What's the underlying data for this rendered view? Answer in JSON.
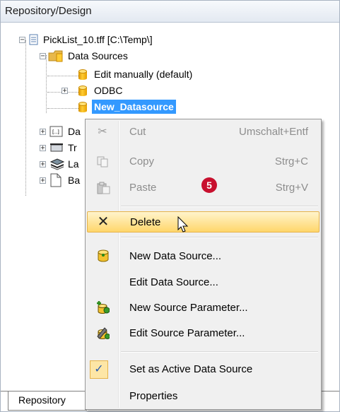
{
  "window": {
    "title": "Repository/Design"
  },
  "tree": {
    "root": "PickList_10.tff [C:\\Temp\\]",
    "data_sources": "Data Sources",
    "items": [
      "Edit manually (default)",
      "ODBC",
      "New_Datasource"
    ],
    "partial": [
      "Da",
      "Tr",
      "La",
      "Ba"
    ]
  },
  "bottom_tab": "Repository",
  "context_menu": {
    "items": [
      {
        "label": "Cut",
        "shortcut": "Umschalt+Entf",
        "icon": "scissors-icon"
      },
      {
        "label": "Copy",
        "shortcut": "Strg+C",
        "icon": "copy-icon"
      },
      {
        "label": "Paste",
        "shortcut": "Strg+V",
        "icon": "paste-icon"
      },
      {
        "label": "Delete",
        "icon": "delete-x-icon"
      },
      {
        "label": "New Data Source...",
        "icon": "new-datasource-icon"
      },
      {
        "label": "Edit Data Source..."
      },
      {
        "label": "New Source Parameter...",
        "icon": "new-parameter-icon"
      },
      {
        "label": "Edit Source Parameter...",
        "icon": "edit-parameter-icon"
      },
      {
        "label": "Set as Active Data Source",
        "icon": "checkmark-icon"
      },
      {
        "label": "Properties"
      }
    ]
  },
  "callout": "5"
}
